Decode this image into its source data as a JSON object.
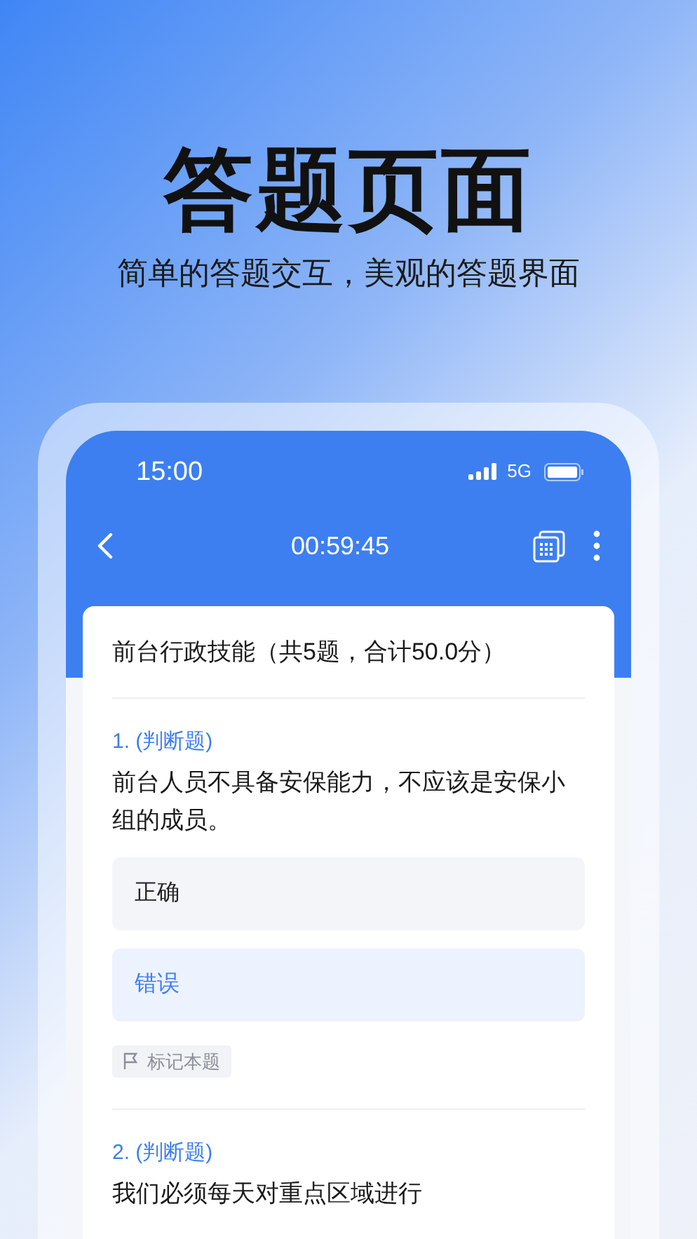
{
  "promo": {
    "title": "答题页面",
    "subtitle": "简单的答题交互，美观的答题界面"
  },
  "status_bar": {
    "time": "15:00",
    "network": "5G"
  },
  "toolbar": {
    "timer": "00:59:45"
  },
  "exam": {
    "title": "前台行政技能（共5题，合计50.0分）"
  },
  "questions": [
    {
      "label": "1. (判断题)",
      "text": "前台人员不具备安保能力，不应该是安保小组的成员。",
      "options": [
        {
          "label": "正确",
          "selected": false
        },
        {
          "label": "错误",
          "selected": true
        }
      ],
      "mark_button": "标记本题"
    },
    {
      "label": "2. (判断题)",
      "text": "我们必须每天对重点区域进行"
    }
  ]
}
